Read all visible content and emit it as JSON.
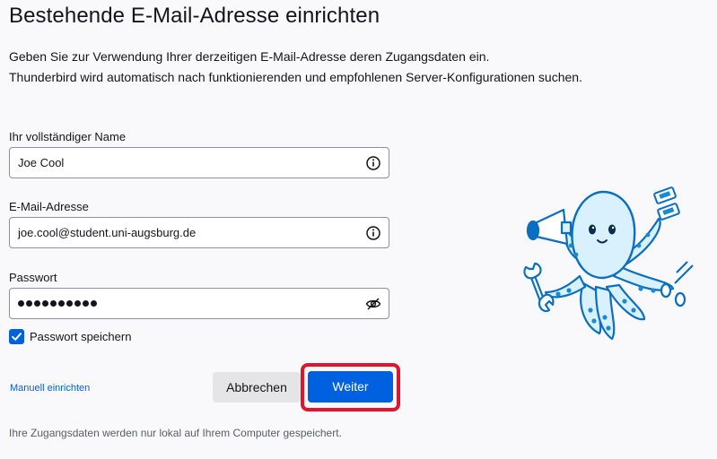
{
  "header": {
    "title": "Bestehende E-Mail-Adresse einrichten",
    "description_line1": "Geben Sie zur Verwendung Ihrer derzeitigen E-Mail-Adresse deren Zugangsdaten ein.",
    "description_line2": "Thunderbird wird automatisch nach funktionierenden und empfohlenen Server-Konfigurationen suchen."
  },
  "form": {
    "name": {
      "label": "Ihr vollständiger Name",
      "value": "Joe Cool",
      "icon": "info-icon"
    },
    "email": {
      "label": "E-Mail-Adresse",
      "value": "joe.cool@student.uni-augsburg.de",
      "icon": "info-icon"
    },
    "password": {
      "label": "Passwort",
      "masked_length": 10,
      "icon": "eye-slash-icon"
    },
    "remember_password": {
      "label": "Passwort speichern",
      "checked": true
    }
  },
  "actions": {
    "manual_label": "Manuell einrichten",
    "cancel_label": "Abbrechen",
    "next_label": "Weiter"
  },
  "footer": {
    "note": "Ihre Zugangsdaten werden nur lokal auf Ihrem Computer gespeichert."
  },
  "colors": {
    "accent": "#0061e0",
    "highlight": "#e0142b",
    "background": "#f9f9fb"
  }
}
